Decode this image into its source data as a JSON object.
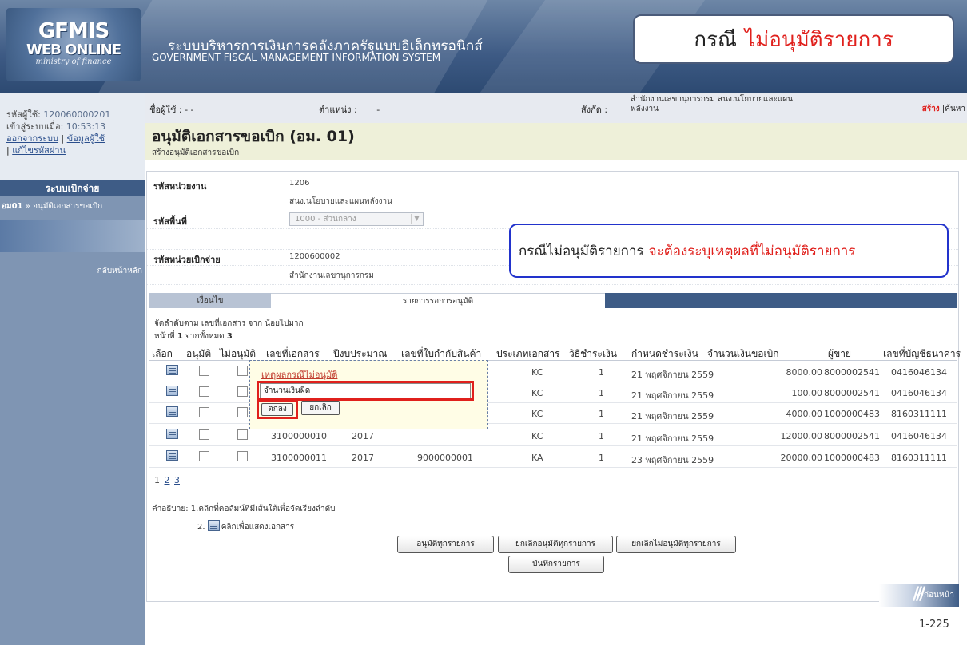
{
  "header": {
    "logo_line1": "GFMIS",
    "logo_line2": "WEB ONLINE",
    "logo_line3": "ministry of finance",
    "system_name_th": "ระบบบริหารการเงินการคลังภาครัฐแบบอิเล็กทรอนิกส์",
    "system_name_en": "GOVERNMENT FISCAL MANAGEMENT INFORMATION SYSTEM",
    "callout_prefix": "กรณี",
    "callout_highlight": "ไม่อนุมัติรายการ"
  },
  "sidebar": {
    "user_id_label": "รหัสผู้ใช้:",
    "user_id": "120060000201",
    "login_label": "เข้าสู่ระบบเมื่อ:",
    "login_time": "10:53:13",
    "logout": "ออกจากระบบ",
    "user_info": "ข้อมูลผู้ใช้",
    "change_password": "แก้ไขรหัสผ่าน",
    "menu_title": "ระบบเบิกจ่าย",
    "menu_item_code": "อม01",
    "menu_item_label": "» อนุมัติเอกสารขอเบิก",
    "back_home": "กลับหน้าหลัก"
  },
  "infobar": {
    "user_label": "ชื่อผู้ใช้ :",
    "user_value": "- -",
    "position_label": "ตำแหน่ง :",
    "position_value": "-",
    "org_label": "สังกัด :",
    "org_value_line1": "สำนักงานเลขานุการกรม สนง.นโยบายและแผน",
    "org_value_line2": "พลังงาน",
    "action_create": "สร้าง",
    "action_search": "ค้นหา"
  },
  "page": {
    "title": "อนุมัติเอกสารขอเบิก (อม. 01)",
    "subtitle": "สร้างอนุมัติเอกสารขอเบิก"
  },
  "form": {
    "agency_label": "รหัสหน่วยงาน",
    "agency_code": "1206",
    "agency_name": "สนง.นโยบายและแผนพลังงาน",
    "area_label": "รหัสพื้นที่",
    "area_value": "1000 - ส่วนกลาง",
    "disb_label": "รหัสหน่วยเบิกจ่าย",
    "disb_code": "1200600002",
    "disb_name": "สำนักงานเลขานุการกรม"
  },
  "callout_mid": {
    "prefix": "กรณีไม่อนุมัติรายการ",
    "highlight": "จะต้องระบุเหตุผลที่ไม่อนุมัติรายการ"
  },
  "tabs": {
    "conditions": "เงื่อนไข",
    "pending": "รายการรอการอนุมัติ"
  },
  "list": {
    "sort_info": "จัดลำดับตาม เลขที่เอกสาร จาก น้อยไปมาก",
    "page_prefix": "หน้าที่",
    "page_current": "1",
    "page_mid": "จากทั้งหมด",
    "page_total": "3",
    "columns": [
      "เลือก",
      "อนุมัติ",
      "ไม่อนุมัติ",
      "เลขที่เอกสาร",
      "ปีงบประมาณ",
      "เลขที่ใบกำกับสินค้า",
      "ประเภทเอกสาร",
      "วิธีชำระเงิน",
      "กำหนดชำระเงิน",
      "จำนวนเงินขอเบิก",
      "ผู้ขาย",
      "เลขที่บัญชีธนาคาร"
    ],
    "rows": [
      {
        "doc_no": "",
        "year": "",
        "invoice": "",
        "type": "KC",
        "method": "1",
        "due": "21 พฤศจิกายน 2559",
        "amount": "8000.00",
        "vendor": "8000002541",
        "account": "0416046134"
      },
      {
        "doc_no": "",
        "year": "",
        "invoice": "",
        "type": "KC",
        "method": "1",
        "due": "21 พฤศจิกายน 2559",
        "amount": "100.00",
        "vendor": "8000002541",
        "account": "0416046134"
      },
      {
        "doc_no": "",
        "year": "",
        "invoice": "",
        "type": "KC",
        "method": "1",
        "due": "21 พฤศจิกายน 2559",
        "amount": "4000.00",
        "vendor": "1000000483",
        "account": "8160311111"
      },
      {
        "doc_no": "3100000010",
        "year": "2017",
        "invoice": "",
        "type": "KC",
        "method": "1",
        "due": "21 พฤศจิกายน 2559",
        "amount": "12000.00",
        "vendor": "8000002541",
        "account": "0416046134"
      },
      {
        "doc_no": "3100000011",
        "year": "2017",
        "invoice": "9000000001",
        "type": "KA",
        "method": "1",
        "due": "23 พฤศจิกายน 2559",
        "amount": "20000.00",
        "vendor": "1000000483",
        "account": "8160311111"
      }
    ],
    "pages": [
      "1",
      "2",
      "3"
    ]
  },
  "popup": {
    "title": "เหตุผลกรณีไม่อนุมัติ",
    "reason_value": "จำนวนเงินผิด",
    "ok": "ตกลง",
    "cancel": "ยกเลิก"
  },
  "legend": {
    "line1": "คำอธิบาย:  1.คลิกที่คอลัมน์ที่มีเส้นใต้เพื่อจัดเรียงลำดับ",
    "line2_num": "2.",
    "line2_text": "คลิกเพื่อแสดงเอกสาร"
  },
  "buttons": {
    "approve_all": "อนุมัติทุกรายการ",
    "cancel_approve_all": "ยกเลิกอนุมัติทุกรายการ",
    "cancel_reject_all": "ยกเลิกไม่อนุมัติทุกรายการ",
    "save": "บันทึกรายการ",
    "back": "« ก่อนหน้า"
  },
  "page_number": "1-225"
}
